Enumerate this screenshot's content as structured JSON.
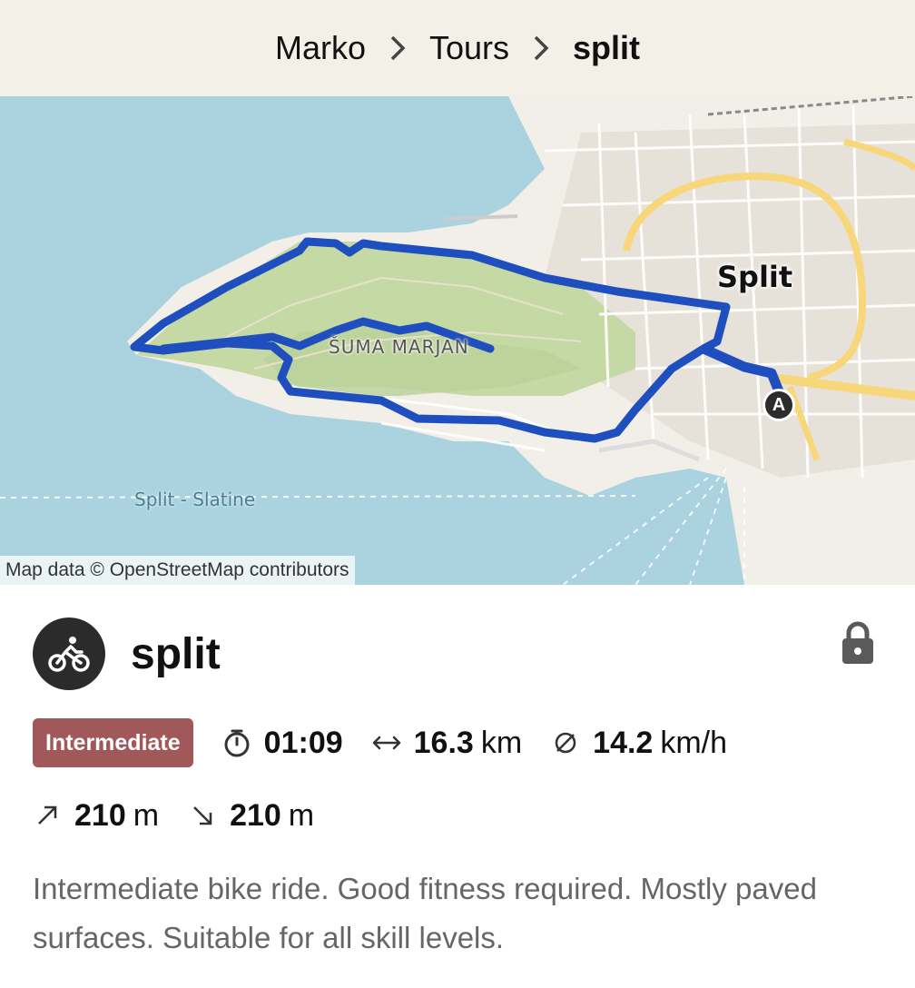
{
  "breadcrumb": {
    "items": [
      "Marko",
      "Tours"
    ],
    "current": "split"
  },
  "map": {
    "city_label": "Split",
    "park_label": "ŠUMA MARJAN",
    "ferry_label": "Split - Slatine",
    "start_marker": "A",
    "attribution": "Map data © OpenStreetMap contributors"
  },
  "tour": {
    "sport_icon": "bicycle-icon",
    "title": "split",
    "visibility_icon": "lock-icon",
    "difficulty": "Intermediate",
    "duration": "01:09",
    "distance": {
      "value": "16.3",
      "unit": "km"
    },
    "avg_speed": {
      "value": "14.2",
      "unit": "km/h"
    },
    "elevation_up": {
      "value": "210",
      "unit": "m"
    },
    "elevation_down": {
      "value": "210",
      "unit": "m"
    },
    "description": "Intermediate bike ride. Good fitness required. Mostly paved surfaces. Suitable for all skill levels."
  },
  "colors": {
    "route": "#1f4fbf",
    "difficulty_badge": "#a0585a",
    "header_bg": "#f3f1e7",
    "water": "#aad3df",
    "park": "#c5d9a5"
  }
}
